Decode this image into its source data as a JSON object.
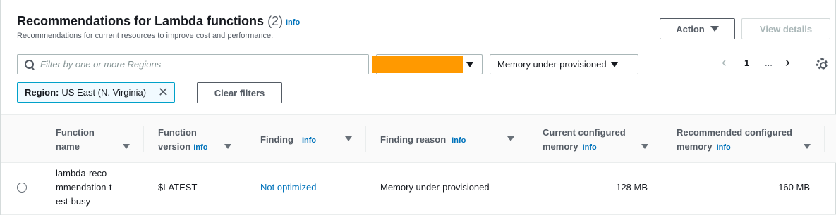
{
  "header": {
    "title": "Recommendations for Lambda functions",
    "count": "(2)",
    "info": "Info",
    "subtitle": "Recommendations for current resources to improve cost and performance."
  },
  "actions": {
    "action_label": "Action",
    "view_details_label": "View details"
  },
  "filters": {
    "search_placeholder": "Filter by one or more Regions",
    "account_select_value": "",
    "finding_select_value": "Memory under-provisioned",
    "token_key": "Region:",
    "token_value": "US East (N. Virginia)",
    "clear_filters_label": "Clear filters"
  },
  "pagination": {
    "current_page": "1",
    "ellipsis": "..."
  },
  "table": {
    "columns": [
      {
        "label": "Function name",
        "info": ""
      },
      {
        "label": "Function version",
        "info": "Info"
      },
      {
        "label": "Finding",
        "info": "Info"
      },
      {
        "label": "Finding reason",
        "info": "Info"
      },
      {
        "label": "Current configured memory",
        "info": "Info"
      },
      {
        "label": "Recommended configured memory",
        "info": "Info"
      }
    ],
    "rows": [
      {
        "function_name": "lambda-recommendation-test-busy",
        "function_version": "$LATEST",
        "finding": "Not optimized",
        "finding_reason": "Memory under-provisioned",
        "current_memory": "128 MB",
        "recommended_memory": "160 MB"
      }
    ]
  },
  "colors": {
    "link": "#0073bb",
    "redaction": "#ff9900",
    "token_border": "#00a1c9"
  }
}
